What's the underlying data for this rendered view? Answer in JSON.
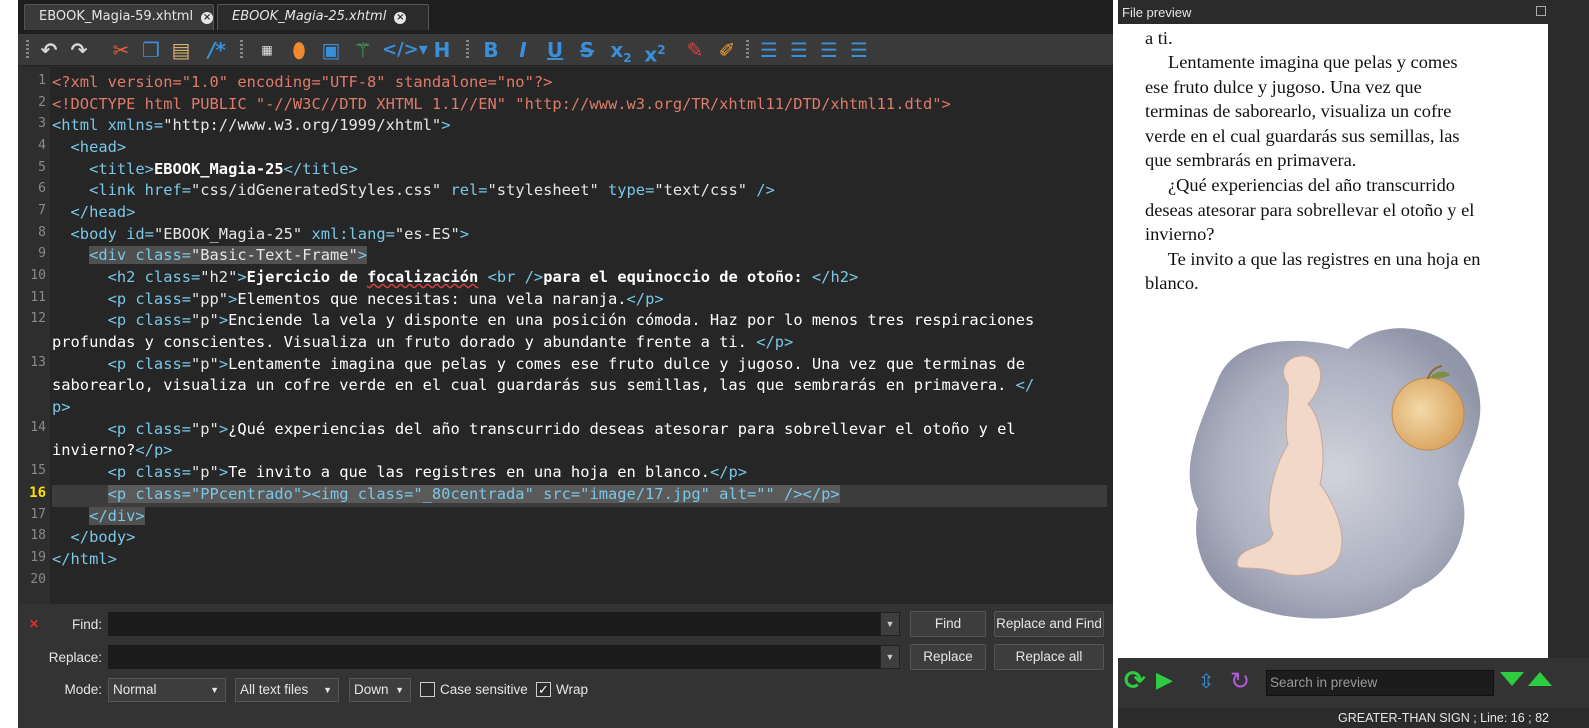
{
  "tabs": [
    {
      "label": "EBOOK_Magia-59.xhtml",
      "active": false
    },
    {
      "label": "EBOOK_Magia-25.xhtml",
      "active": true
    }
  ],
  "code": {
    "lines": [
      {
        "n": "1"
      },
      {
        "n": "2"
      },
      {
        "n": "3"
      },
      {
        "n": "4"
      },
      {
        "n": "5"
      },
      {
        "n": "6"
      },
      {
        "n": "7"
      },
      {
        "n": "8"
      },
      {
        "n": "9"
      },
      {
        "n": "10"
      },
      {
        "n": "11"
      },
      {
        "n": "12"
      },
      {
        "n": "13"
      },
      {
        "n": "14"
      },
      {
        "n": "15"
      },
      {
        "n": "16"
      },
      {
        "n": "17"
      },
      {
        "n": "18"
      },
      {
        "n": "19"
      },
      {
        "n": "20"
      }
    ],
    "current_line": "16",
    "l1": "<?xml version=\"1.0\" encoding=\"UTF-8\" standalone=\"no\"?>",
    "l2": "<!DOCTYPE html PUBLIC \"-//W3C//DTD XHTML 1.1//EN\" \"http://www.w3.org/TR/xhtml11/DTD/xhtml11.dtd\">",
    "l3_open": "<html xmlns=",
    "l3_val": "\"http://www.w3.org/1999/xhtml\"",
    "l3_close": ">",
    "l4": "  <head>",
    "l5_open": "    <title>",
    "l5_text": "EBOOK_Magia-25",
    "l5_close": "</title>",
    "l6_open": "    <link href=",
    "l6_v1": "\"css/idGeneratedStyles.css\"",
    "l6_a2": " rel=",
    "l6_v2": "\"stylesheet\"",
    "l6_a3": " type=",
    "l6_v3": "\"text/css\"",
    "l6_close": " />",
    "l7": "  </head>",
    "l8_open": "  <body id=",
    "l8_v1": "\"EBOOK_Magia-25\"",
    "l8_a2": " xml:lang=",
    "l8_v2": "\"es-ES\"",
    "l8_close": ">",
    "l9_indent": "    ",
    "l9_open": "<div class=",
    "l9_v1": "\"Basic-Text-Frame\"",
    "l9_close": ">",
    "l10_open": "      <h2 class=",
    "l10_v1": "\"h2\"",
    "l10_c1": ">",
    "l10_t1": "Ejercicio de ",
    "l10_t2": "focalización",
    "l10_t3": " ",
    "l10_br": "<br />",
    "l10_t4": "para el equinoccio de otoño: ",
    "l10_close": "</h2>",
    "l11_open": "      <p class=",
    "l11_v1": "\"pp\"",
    "l11_c1": ">",
    "l11_text": "Elementos que necesitas: una vela naranja.",
    "l11_close": "</p>",
    "l12a_open": "      <p class=",
    "l12a_v1": "\"p\"",
    "l12a_c1": ">",
    "l12a_text": "Enciende la vela y disponte en una posición cómoda. Haz por lo menos tres respiraciones",
    "l12b_text": "profundas y conscientes. Visualiza un fruto dorado y abundante frente a ti. ",
    "l12b_close": "</p>",
    "l13a_open": "      <p class=",
    "l13a_v1": "\"p\"",
    "l13a_c1": ">",
    "l13a_text": "Lentamente imagina que pelas y comes ese fruto dulce y jugoso. Una vez que terminas de",
    "l13b_text": "saborearlo, visualiza un cofre verde en el cual guardarás sus semillas, las que sembrarás en primavera. ",
    "l13b_close": "</",
    "l13c_close": "p>",
    "l14a_open": "      <p class=",
    "l14a_v1": "\"p\"",
    "l14a_c1": ">",
    "l14a_text": "¿Qué experiencias del año transcurrido deseas atesorar para sobrellevar el otoño y el",
    "l14b_text": "invierno?",
    "l14b_close": "</p>",
    "l15_open": "      <p class=",
    "l15_v1": "\"p\"",
    "l15_c1": ">",
    "l15_text": "Te invito a que las registres en una hoja en blanco.",
    "l15_close": "</p>",
    "l16_indent": "      ",
    "l16_code": "<p class=\"PPcentrado\"><img class=\"_80centrada\" src=\"image/17.jpg\" alt=\"\" /></p>",
    "l17_indent": "    ",
    "l17_code": "</div>",
    "l18": "  </body>",
    "l19": "</html>"
  },
  "findbar": {
    "find_label": "Find:",
    "replace_label": "Replace:",
    "mode_label": "Mode:",
    "mode_value": "Normal",
    "scope_value": "All text files",
    "direction_value": "Down",
    "case_label": "Case sensitive",
    "case_checked": false,
    "wrap_label": "Wrap",
    "wrap_checked": true,
    "find_btn": "Find",
    "replace_find_btn": "Replace and Find",
    "replace_btn": "Replace",
    "replace_all_btn": "Replace all"
  },
  "preview": {
    "title": "File preview",
    "lines": [
      "a ti.",
      "     Lentamente imagina que pelas y comes",
      "ese fruto dulce y jugoso. Una vez que",
      "terminas de saborearlo, visualiza un cofre",
      "verde en el cual guardarás sus semillas, las",
      "que sembrarás en primavera.",
      "     ¿Qué experiencias del año transcurrido",
      "deseas atesorar para sobrellevar el otoño y el",
      "invierno?",
      "     Te invito a que las registres en una hoja en",
      "blanco."
    ],
    "search_placeholder": "Search in preview"
  },
  "status": {
    "text": "GREATER-THAN SIGN ; Line: 16 ; 82"
  },
  "colors": {
    "accent_green": "#2ecc40",
    "accent_blue": "#3a8fd8",
    "accent_purple": "#b15cd8"
  }
}
